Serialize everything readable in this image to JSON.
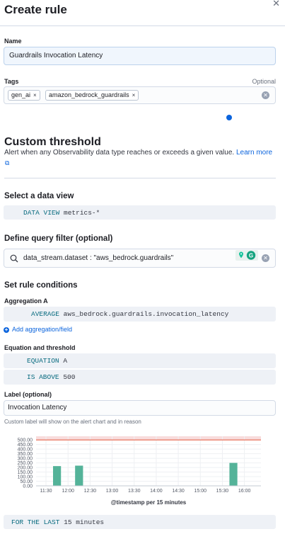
{
  "flyout": {
    "title": "Create rule",
    "close_icon": "close-icon"
  },
  "name_section": {
    "label": "Name",
    "value": "Guardrails Invocation Latency"
  },
  "tags_section": {
    "label": "Tags",
    "optional": "Optional",
    "tags": [
      "gen_ai",
      "amazon_bedrock_guardrails"
    ],
    "remove_glyph": "×",
    "clear_icon": "clear-icon"
  },
  "threshold": {
    "title": "Custom threshold",
    "description": "Alert when any Observability data type reaches or exceeds a given value.",
    "learn_more": "Learn more",
    "external_icon": "external-link-icon"
  },
  "data_view": {
    "heading": "Select a data view",
    "keyword": "DATA VIEW",
    "value": "metrics-*"
  },
  "query_filter": {
    "heading": "Define query filter (optional)",
    "value": "data_stream.dataset : \"aws_bedrock.guardrails\"",
    "search_icon": "search-icon"
  },
  "conditions": {
    "heading": "Set rule conditions",
    "aggregation_label": "Aggregation A",
    "aggregation_keyword": "AVERAGE",
    "aggregation_field": "aws_bedrock.guardrails.invocation_latency",
    "add_aggregation": "Add aggregation/field",
    "equation_heading": "Equation and threshold",
    "equation_keyword": "EQUATION",
    "equation_value": "A",
    "is_above_keyword": "IS ABOVE",
    "is_above_value": "500",
    "label_heading": "Label (optional)",
    "label_value": "Invocation Latency",
    "label_help": "Custom label will show on the alert chart and in reason"
  },
  "chart_data": {
    "type": "bar",
    "xlabel": "@timestamp per 15 minutes",
    "ylabel": "",
    "x_ticks": [
      "11:30",
      "12:00",
      "12:30",
      "13:00",
      "13:30",
      "14:00",
      "14:30",
      "15:00",
      "15:30",
      "16:00"
    ],
    "y_ticks": [
      "500.00",
      "450.00",
      "400.00",
      "350.00",
      "300.00",
      "250.00",
      "200.00",
      "150.00",
      "100.00",
      "50.00",
      "0.00"
    ],
    "ylim": [
      0,
      540
    ],
    "threshold": 500,
    "categories": [
      "11:45",
      "12:15",
      "15:45"
    ],
    "values": [
      215,
      220,
      250
    ],
    "colors": {
      "bar": "#54b399",
      "threshold_line": "#e7664c",
      "threshold_fill": "#f8dcdc",
      "grid": "#eef0f3"
    },
    "grid": true
  },
  "lookback": {
    "keyword": "FOR THE LAST",
    "value": "15 minutes"
  },
  "colors": {
    "accent": "#0b64dd",
    "keyword": "#0a6c80"
  }
}
